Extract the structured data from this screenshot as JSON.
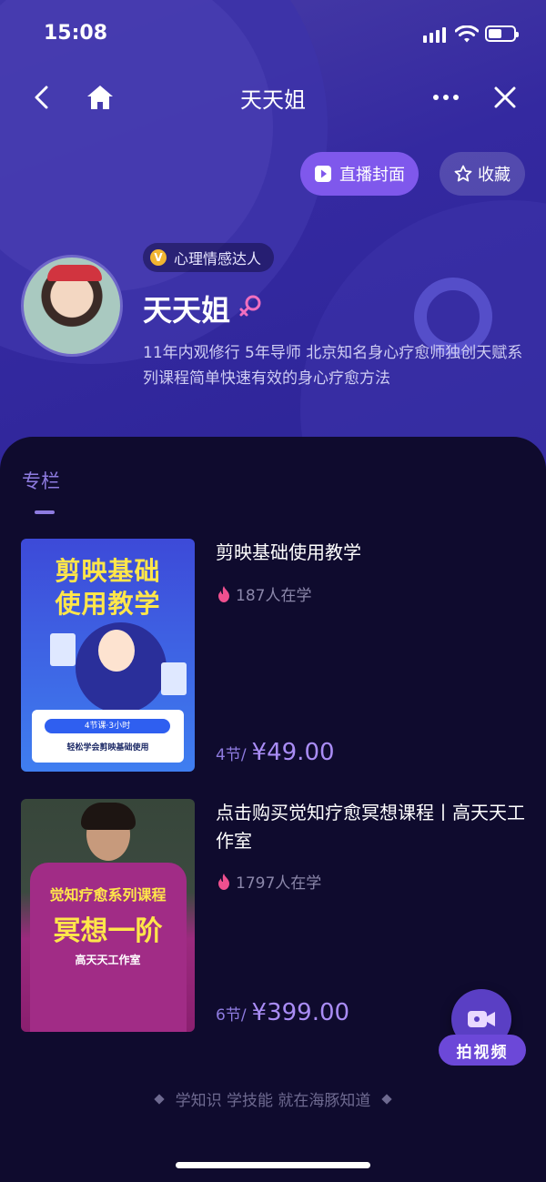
{
  "status_bar": {
    "time": "15:08"
  },
  "nav": {
    "title": "天天姐"
  },
  "actions": {
    "live_cover": "直播封面",
    "favorite": "收藏"
  },
  "profile": {
    "badge": "心理情感达人",
    "name": "天天姐",
    "bio": "11年内观修行 5年导师 北京知名身心疗愈师独创天赋系列课程简单快速有效的身心疗愈方法"
  },
  "section": {
    "title": "专栏"
  },
  "courses": [
    {
      "title": "剪映基础使用教学",
      "learners": "187人在学",
      "lessons": "4节/",
      "price": "¥49.00",
      "cover": {
        "line1": "剪映基础",
        "line2": "使用教学",
        "pill": "4节课·3小时",
        "sub": "轻松学会剪映基础使用"
      }
    },
    {
      "title": "点击购买觉知疗愈冥想课程丨高天天工作室",
      "learners": "1797人在学",
      "lessons": "6节/",
      "price": "¥399.00",
      "cover": {
        "line1": "觉知疗愈系列课程",
        "line2": "冥想一阶",
        "line3": "高天天工作室"
      }
    }
  ],
  "fab": {
    "label": "拍视频"
  },
  "footer": {
    "slogan": "学知识 学技能 就在海豚知道"
  }
}
